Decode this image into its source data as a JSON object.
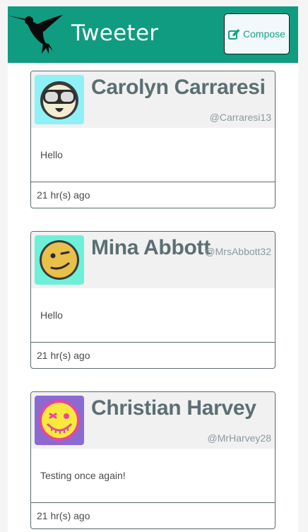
{
  "header": {
    "brand": "Tweeter",
    "compose_label": "Compose",
    "logo_icon": "hummingbird-icon",
    "compose_icon": "edit-icon",
    "brand_color": "#0f9c80"
  },
  "tweets": [
    {
      "name": "Carolyn Carraresi",
      "handle": "@Carraresi13",
      "text": "Hello",
      "time": "21 hr(s) ago",
      "avatar_icon": "goggles-face-icon",
      "avatar_bg": "#8ff1f5"
    },
    {
      "name": "Mina Abbott",
      "handle": "@MrsAbbott32",
      "text": "Hello",
      "time": "21 hr(s) ago",
      "avatar_icon": "winking-face-icon",
      "avatar_bg": "#6ef0d8"
    },
    {
      "name": "Christian Harvey",
      "handle": "@MrHarvey28",
      "text": "Testing once again!",
      "time": "21 hr(s) ago",
      "avatar_icon": "stitched-grin-face-icon",
      "avatar_bg": "#8b6ad2"
    }
  ]
}
